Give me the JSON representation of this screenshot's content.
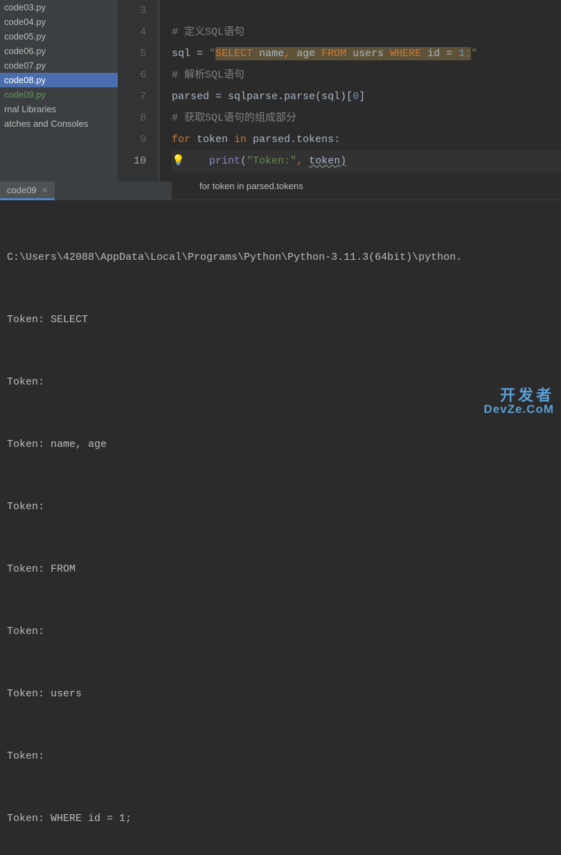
{
  "sidebar": {
    "items": [
      {
        "label": "code03.py",
        "state": ""
      },
      {
        "label": "code04.py",
        "state": ""
      },
      {
        "label": "code05.py",
        "state": ""
      },
      {
        "label": "code06.py",
        "state": ""
      },
      {
        "label": "code07.py",
        "state": ""
      },
      {
        "label": "code08.py",
        "state": "selected"
      },
      {
        "label": "code09.py",
        "state": "highlighted"
      },
      {
        "label": "rnal Libraries",
        "state": ""
      },
      {
        "label": "atches and Consoles",
        "state": ""
      }
    ]
  },
  "editor": {
    "lines": {
      "num3": "3",
      "num4": "4",
      "num5": "5",
      "num6": "6",
      "num7": "7",
      "num8": "8",
      "num9": "9",
      "num10": "10"
    },
    "comment4_prefix": "# ",
    "comment4_text": "定义SQL语句",
    "line5_var": "sql ",
    "line5_eq": "= ",
    "line5_q1": "\"",
    "line5_sql_select": "SELECT ",
    "line5_sql_cols": "name",
    "line5_sql_comma": ", ",
    "line5_sql_age": "age ",
    "line5_sql_from": "FROM ",
    "line5_sql_users": "users ",
    "line5_sql_where": "WHERE ",
    "line5_sql_id": "id ",
    "line5_sql_eq": "= ",
    "line5_sql_num": "1",
    "line5_sql_semi": ";",
    "line5_q2": "\"",
    "comment6_prefix": "# ",
    "comment6_text": "解析SQL语句",
    "line7_parsed": "parsed ",
    "line7_eq": "= ",
    "line7_call": "sqlparse.parse(sql)[",
    "line7_idx": "0",
    "line7_close": "]",
    "comment8_prefix": "# ",
    "comment8_text": "获取SQL语句的组成部分",
    "line9_for": "for ",
    "line9_token": "token ",
    "line9_in": "in ",
    "line9_expr": "parsed.tokens:",
    "line10_indent": "    ",
    "line10_print": "print",
    "line10_open": "(",
    "line10_str": "\"Token:\"",
    "line10_comma": ", ",
    "line10_tok": "token",
    "line10_close": ")"
  },
  "breadcrumb": "for token in parsed.tokens",
  "tab": {
    "label": "code09",
    "close": "×"
  },
  "console": {
    "path": "C:\\Users\\42088\\AppData\\Local\\Programs\\Python\\Python-3.11.3(64bit)\\python.",
    "lines": [
      "Token: SELECT",
      "Token: ",
      "Token: name, age",
      "Token: ",
      "Token: FROM",
      "Token: ",
      "Token: users",
      "Token: ",
      "Token: WHERE id = 1;"
    ]
  },
  "watermark": {
    "cn": "开发者",
    "en": "DevZe.CoM"
  }
}
